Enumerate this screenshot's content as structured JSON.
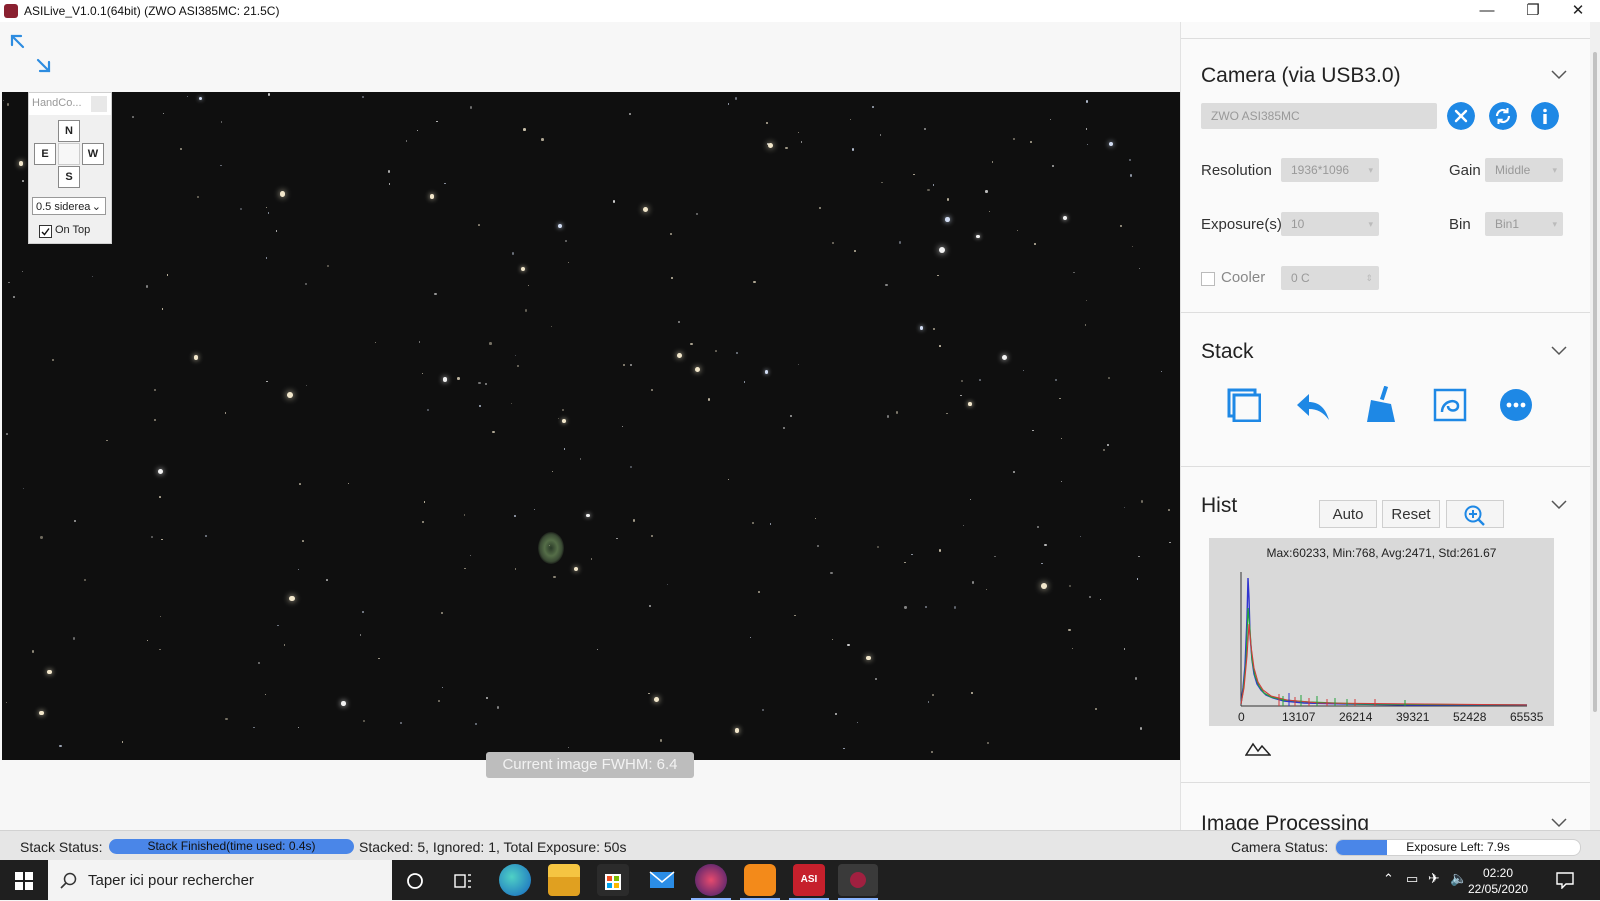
{
  "window": {
    "title": "ASILive_V1.0.1(64bit)  (ZWO ASI385MC: 21.5C)",
    "controls": [
      "—",
      "❐",
      "✕"
    ]
  },
  "viewer": {
    "fwhm_label": "Current image FWHM: 6.4"
  },
  "hand_controller": {
    "title": "HandCo...",
    "north": "N",
    "east": "E",
    "west": "W",
    "south": "S",
    "rate": "0.5 siderea",
    "on_top_label": "On Top",
    "on_top_checked": true
  },
  "camera": {
    "title": "Camera (via USB3.0)",
    "device": "ZWO ASI385MC",
    "resolution_label": "Resolution",
    "resolution_value": "1936*1096",
    "gain_label": "Gain",
    "gain_value": "Middle",
    "exposure_label": "Exposure(s)",
    "exposure_value": "10",
    "bin_label": "Bin",
    "bin_value": "Bin1",
    "cooler_label": "Cooler",
    "cooler_checked": false,
    "cooler_value": "0 C"
  },
  "stack": {
    "title": "Stack"
  },
  "hist": {
    "title": "Hist",
    "auto_label": "Auto",
    "reset_label": "Reset",
    "stats": "Max:60233, Min:768, Avg:2471, Std:261.67",
    "ticks": [
      "0",
      "13107",
      "26214",
      "39321",
      "52428",
      "65535"
    ]
  },
  "image_processing": {
    "title": "Image Processing"
  },
  "status": {
    "stack_status_label": "Stack Status:",
    "stack_progress_text": "Stack Finished(time used: 0.4s)",
    "stack_progress": 1.0,
    "stack_summary": "Stacked: 5, Ignored: 1, Total Exposure: 50s",
    "camera_status_label": "Camera Status:",
    "camera_progress_text": "Exposure Left: 7.9s",
    "camera_progress": 0.21
  },
  "taskbar": {
    "search_placeholder": "Taper ici pour rechercher",
    "time": "02:20",
    "date": "22/05/2020"
  },
  "colors": {
    "accent_blue": "#1e88e5",
    "progress_blue": "#4a86e8",
    "sky_background": "#0f0f0f"
  }
}
